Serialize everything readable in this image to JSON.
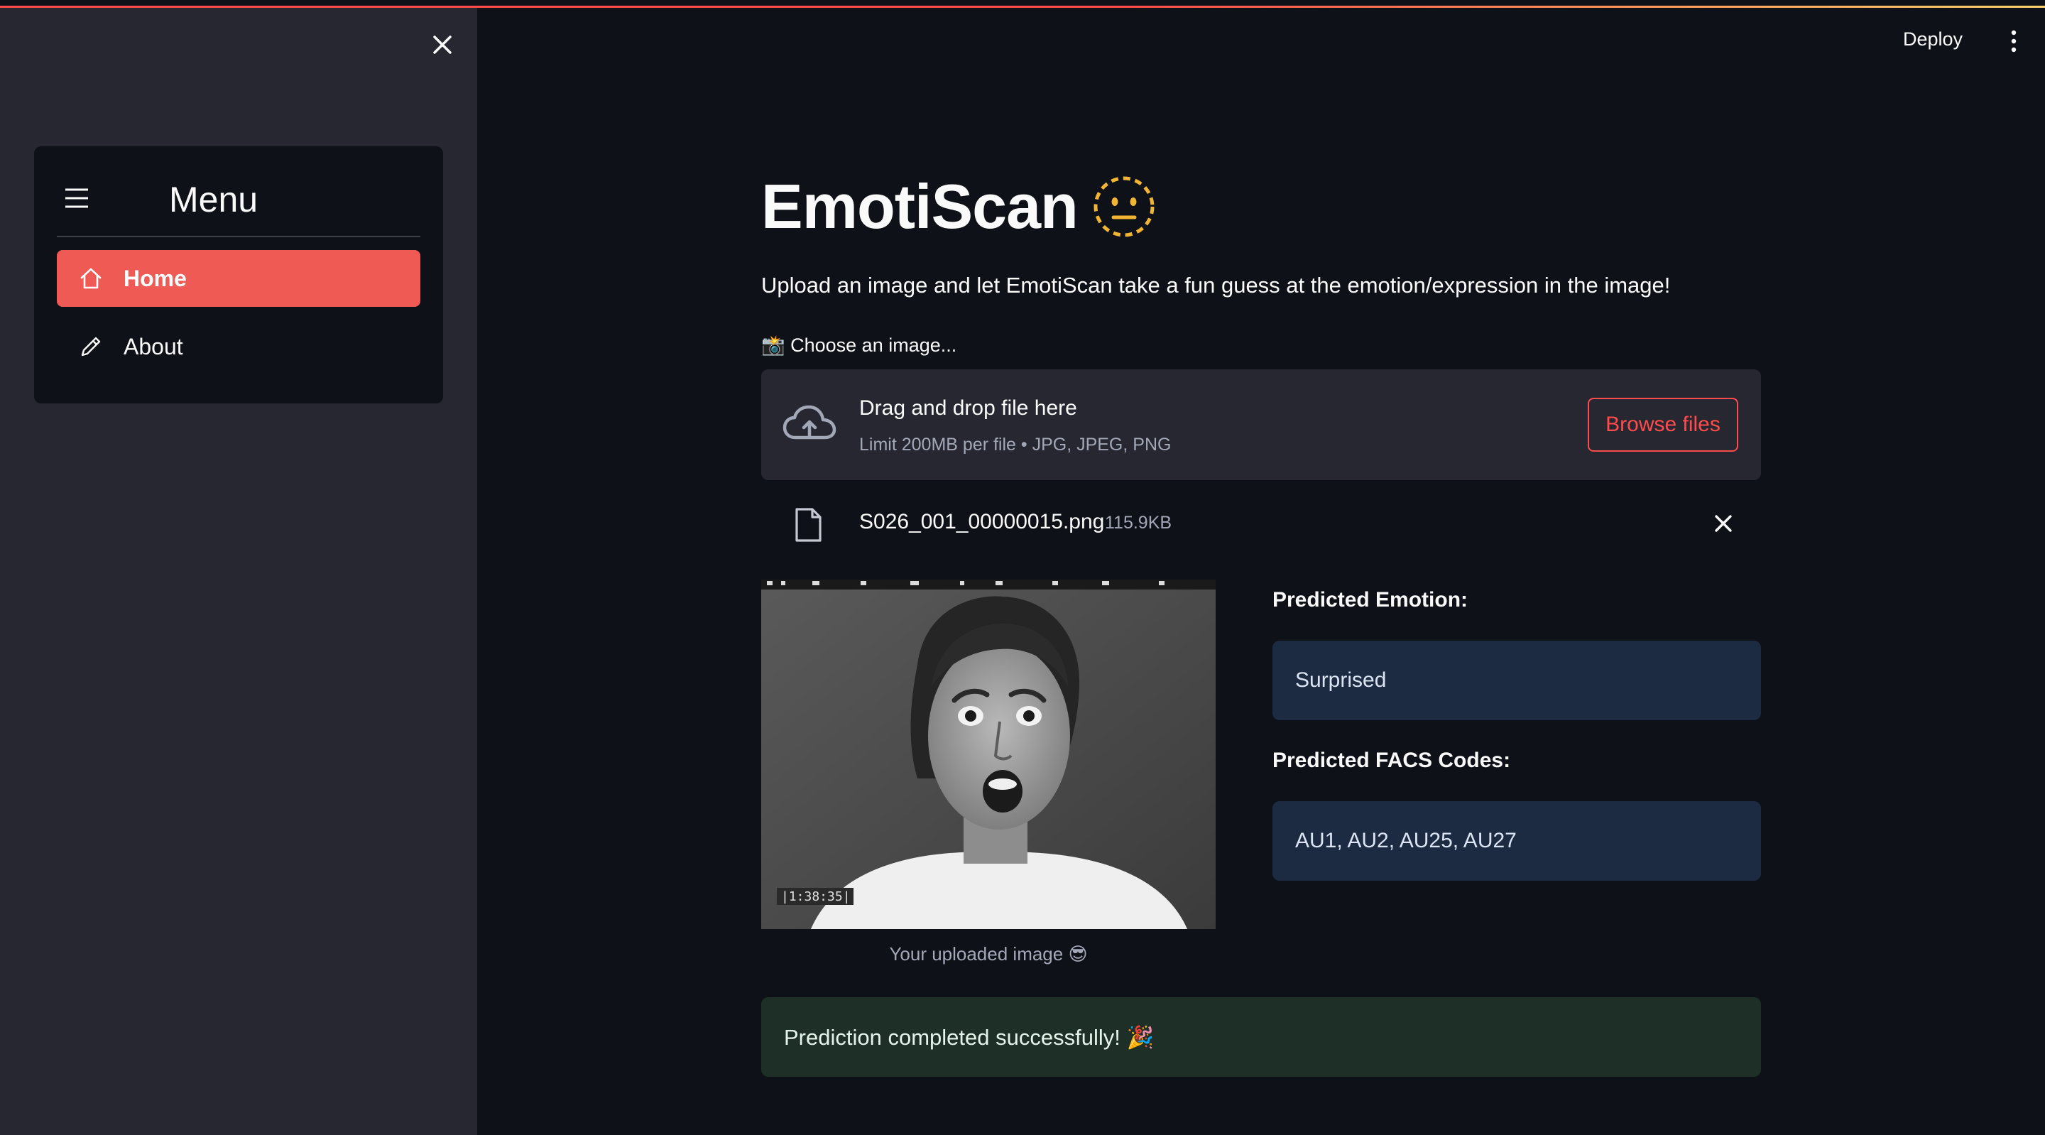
{
  "sidebar": {
    "menu_title": "Menu",
    "items": [
      {
        "label": "Home",
        "icon": "home-icon",
        "active": true
      },
      {
        "label": "About",
        "icon": "pencil-icon",
        "active": false
      }
    ]
  },
  "header": {
    "deploy_label": "Deploy"
  },
  "main": {
    "title": "EmotiScan",
    "title_emoji": "neutral-face-dashed-icon",
    "subtitle": "Upload an image and let EmotiScan take a fun guess at the emotion/expression in the image!",
    "uploader": {
      "label": "📸 Choose an image...",
      "drop_title": "Drag and drop file here",
      "limit_text": "Limit 200MB per file • JPG, JPEG, PNG",
      "browse_label": "Browse files"
    },
    "file": {
      "name": "S026_001_00000015.png",
      "size": "115.9KB"
    },
    "image_caption": "Your uploaded image 😎",
    "prediction": {
      "emotion_label": "Predicted Emotion:",
      "emotion_value": "Surprised",
      "facs_label": "Predicted FACS Codes:",
      "facs_value": "AU1, AU2, AU25, AU27"
    },
    "success_message": "Prediction completed successfully! 🎉"
  },
  "colors": {
    "accent": "#ff4b4b",
    "sidebar_bg": "#262730",
    "main_bg": "#0e1117",
    "info_bg": "#1c2a42",
    "success_bg": "#1d2f27"
  }
}
